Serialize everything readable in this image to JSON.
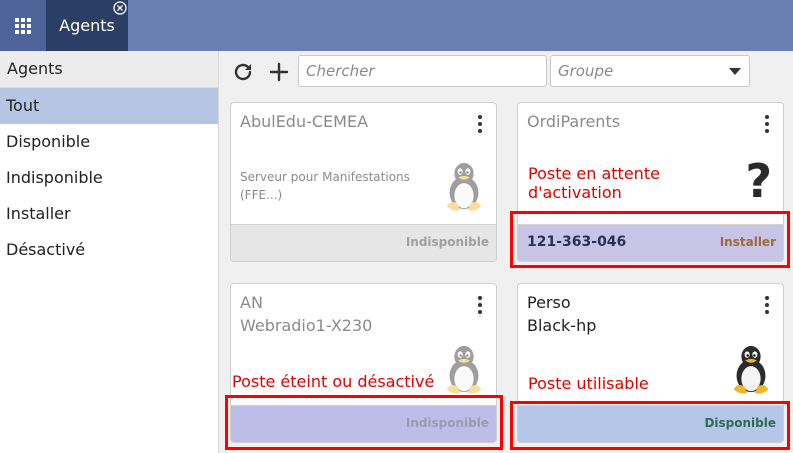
{
  "colors": {
    "topbar": "#6a80b4",
    "tab_active": "#2b3e66",
    "sidebar_active": "#b7c5e4",
    "annotation": "#e00000",
    "status_disponible": "#2e6b54",
    "status_installer": "#9b6a3e",
    "status_indisponible": "#a0a0a0"
  },
  "topbar": {
    "app_grid_icon": "grid-icon",
    "tab_label": "Agents",
    "tab_close_icon": "close-icon"
  },
  "sidebar": {
    "header": "Agents",
    "items": [
      {
        "label": "Tout",
        "active": true
      },
      {
        "label": "Disponible"
      },
      {
        "label": "Indisponible"
      },
      {
        "label": "Installer"
      },
      {
        "label": "Désactivé"
      }
    ]
  },
  "toolbar": {
    "refresh_icon": "refresh-icon",
    "add_icon": "plus-icon",
    "search_placeholder": "Chercher",
    "group_placeholder": "Groupe"
  },
  "cards": [
    {
      "name": "AbulEdu-CEMEA",
      "description": "Serveur pour Manifestations (FFE...)",
      "icon": "tux-icon",
      "status": "Indisponible"
    },
    {
      "name": "OrdiParents",
      "icon": "question-icon",
      "code": "121-363-046",
      "status": "Installer"
    },
    {
      "name": "AN",
      "name2": "Webradio1-X230",
      "icon": "tux-icon",
      "status": "Indisponible"
    },
    {
      "name": "Perso",
      "name2": "Black-hp",
      "icon": "tux-icon",
      "status": "Disponible"
    }
  ],
  "annotations": {
    "attente_line1": "Poste en attente",
    "attente_line2": "d'activation",
    "eteint": "Poste éteint ou désactivé",
    "utilisable": "Poste utilisable"
  }
}
